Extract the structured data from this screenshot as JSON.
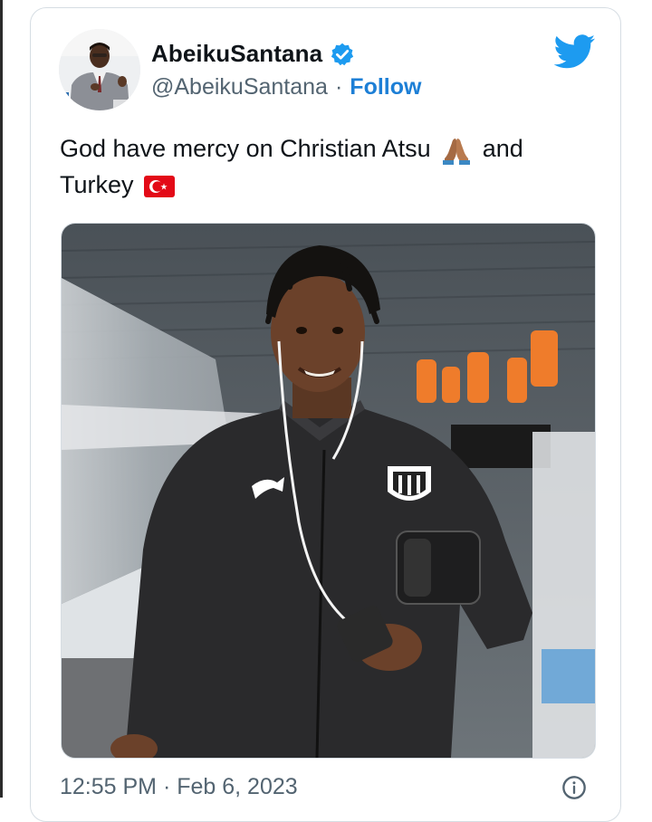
{
  "tweet": {
    "display_name": "AbeikuSantana",
    "handle": "@AbeikuSantana",
    "separator": "·",
    "follow_label": "Follow",
    "text_line1": "God have mercy on Christian Atsu",
    "text_and": "and",
    "text_line2": "Turkey",
    "timestamp": "12:55 PM · Feb 6, 2023"
  },
  "icons": {
    "verified": "verified-badge-icon",
    "brand": "twitter-bird-icon",
    "praying": "praying-hands-emoji",
    "flag": "turkey-flag-emoji",
    "info": "info-icon"
  },
  "colors": {
    "brand_blue": "#1d9bf0",
    "follow_blue": "#1d7fd6",
    "text_primary": "#0f1419",
    "text_secondary": "#536471"
  }
}
